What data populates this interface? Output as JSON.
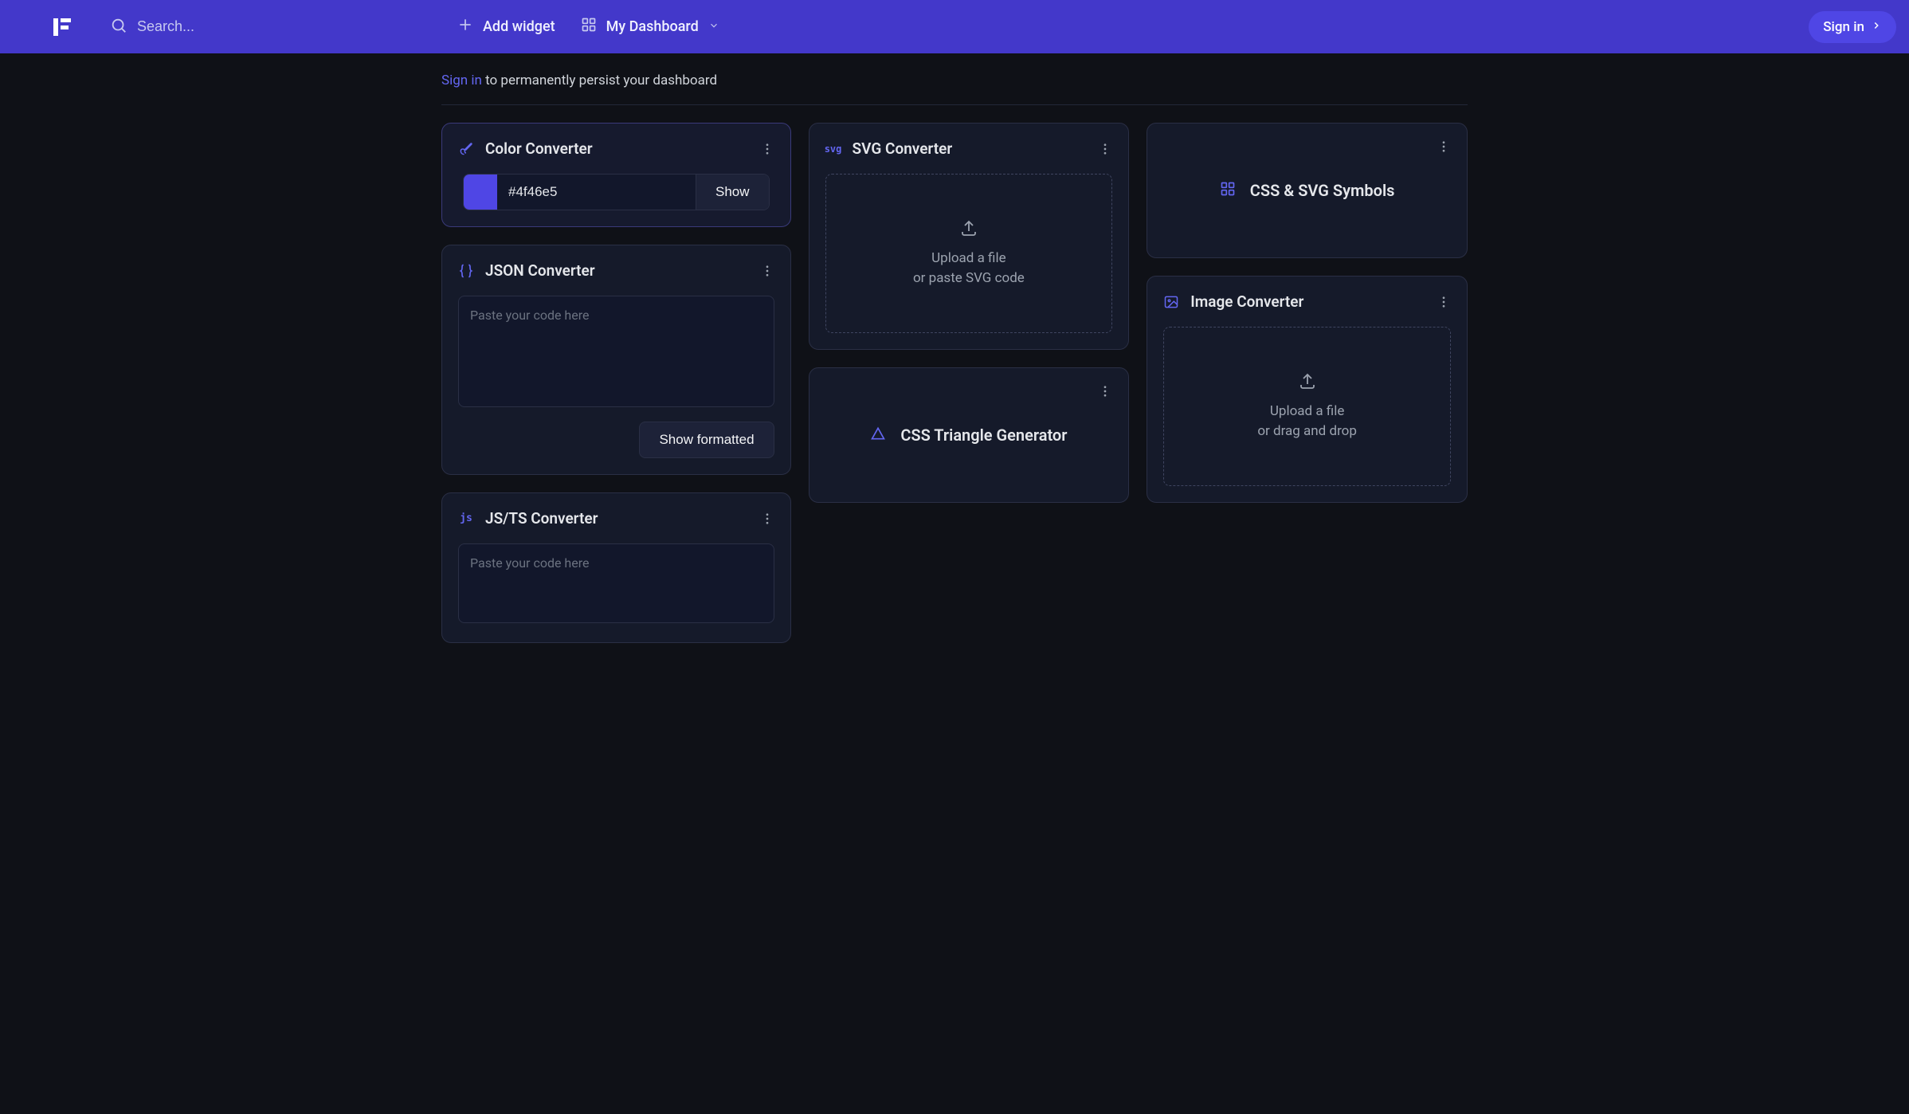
{
  "header": {
    "searchPlaceholder": "Search...",
    "addWidget": "Add widget",
    "myDashboard": "My Dashboard",
    "signIn": "Sign in"
  },
  "banner": {
    "linkText": "Sign in",
    "suffix": " to permanently persist your dashboard"
  },
  "widgets": {
    "color": {
      "title": "Color Converter",
      "value": "#4f46e5",
      "showLabel": "Show",
      "swatchColor": "#4f46e5"
    },
    "json": {
      "title": "JSON Converter",
      "placeholder": "Paste your code here",
      "buttonLabel": "Show formatted"
    },
    "jsts": {
      "title": "JS/TS Converter",
      "iconLabel": "js",
      "placeholder": "Paste your code here"
    },
    "svg": {
      "title": "SVG Converter",
      "iconLabel": "svg",
      "dzLine1": "Upload a file",
      "dzLine2": "or paste SVG code"
    },
    "triangle": {
      "title": "CSS Triangle Generator"
    },
    "symbols": {
      "title": "CSS & SVG Symbols"
    },
    "image": {
      "title": "Image Converter",
      "dzLine1": "Upload a file",
      "dzLine2": "or drag and drop"
    }
  }
}
